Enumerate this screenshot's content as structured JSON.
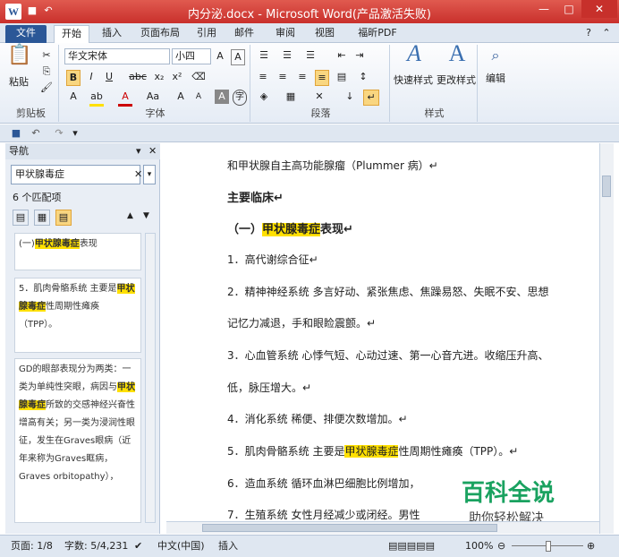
{
  "title": "内分泌.docx - Microsoft Word(产品激活失败)",
  "tabs": [
    "文件",
    "开始",
    "插入",
    "页面布局",
    "引用",
    "邮件",
    "审阅",
    "视图",
    "福昕PDF"
  ],
  "ribbon": {
    "clipboard": {
      "paste": "粘贴",
      "group": "剪贴板"
    },
    "font": {
      "name": "华文宋体",
      "size": "小四",
      "group": "字体"
    },
    "paragraph": {
      "group": "段落"
    },
    "styles": {
      "quick": "快速样式",
      "change": "更改样式",
      "group": "样式"
    },
    "editing": {
      "label": "编辑"
    }
  },
  "nav": {
    "title": "导航",
    "search": "甲状腺毒症",
    "count": "6 个匹配项",
    "results": [
      {
        "pre": "(一)",
        "hit": "甲状腺毒症",
        "post": "表现"
      },
      {
        "pre": "5．肌肉骨骼系统 主要是",
        "hit": "甲状腺毒症",
        "post": "性周期性瘫痪（TPP）。"
      },
      {
        "pre": "GD的眼部表现分为两类：一类为单纯性突眼，病因与",
        "hit": "甲状腺毒症",
        "post": "所致的交感神经兴奋性增高有关；另一类为浸润性眼征，发生在Graves眼病（近年来称为Graves眶病，Graves orbitopathy），"
      }
    ]
  },
  "doc": {
    "l1": "和甲状腺自主高功能腺瘤（Plummer 病）↵",
    "l2": "主要临床↵",
    "l3a": "（一）",
    "l3b": "甲状腺毒症",
    "l3c": "表现↵",
    "l4": "1．高代谢综合征↵",
    "l5": "2．精神神经系统  多言好动、紧张焦虑、焦躁易怒、失眠不安、思想",
    "l6": "记忆力减退，手和眼睑震颤。↵",
    "l7": "3．心血管系统  心悸气短、心动过速、第一心音亢进。收缩压升高、",
    "l8": "低，脉压增大。↵",
    "l9": "4．消化系统  稀便、排便次数增加。↵",
    "l10a": "5．肌肉骨骼系统  主要是",
    "l10b": "甲状腺毒症",
    "l10c": "性周期性瘫痪（TPP）。↵",
    "l11": "6．造血系统  循环血淋巴细胞比例增加，",
    "l12": "7．生殖系统  女性月经减少或闭经。男性"
  },
  "watermark": {
    "big": "百科全说",
    "small": "助你轻松解决"
  },
  "status": {
    "page": "页面: 1/8",
    "words": "字数: 5/4,231",
    "lang": "中文(中国)",
    "mode": "插入",
    "zoom": "100%"
  },
  "colors": {
    "titlebar": "#c9302c",
    "highlight": "#ffe000",
    "accent": "#2b5797",
    "watermark": "#1aa260"
  }
}
